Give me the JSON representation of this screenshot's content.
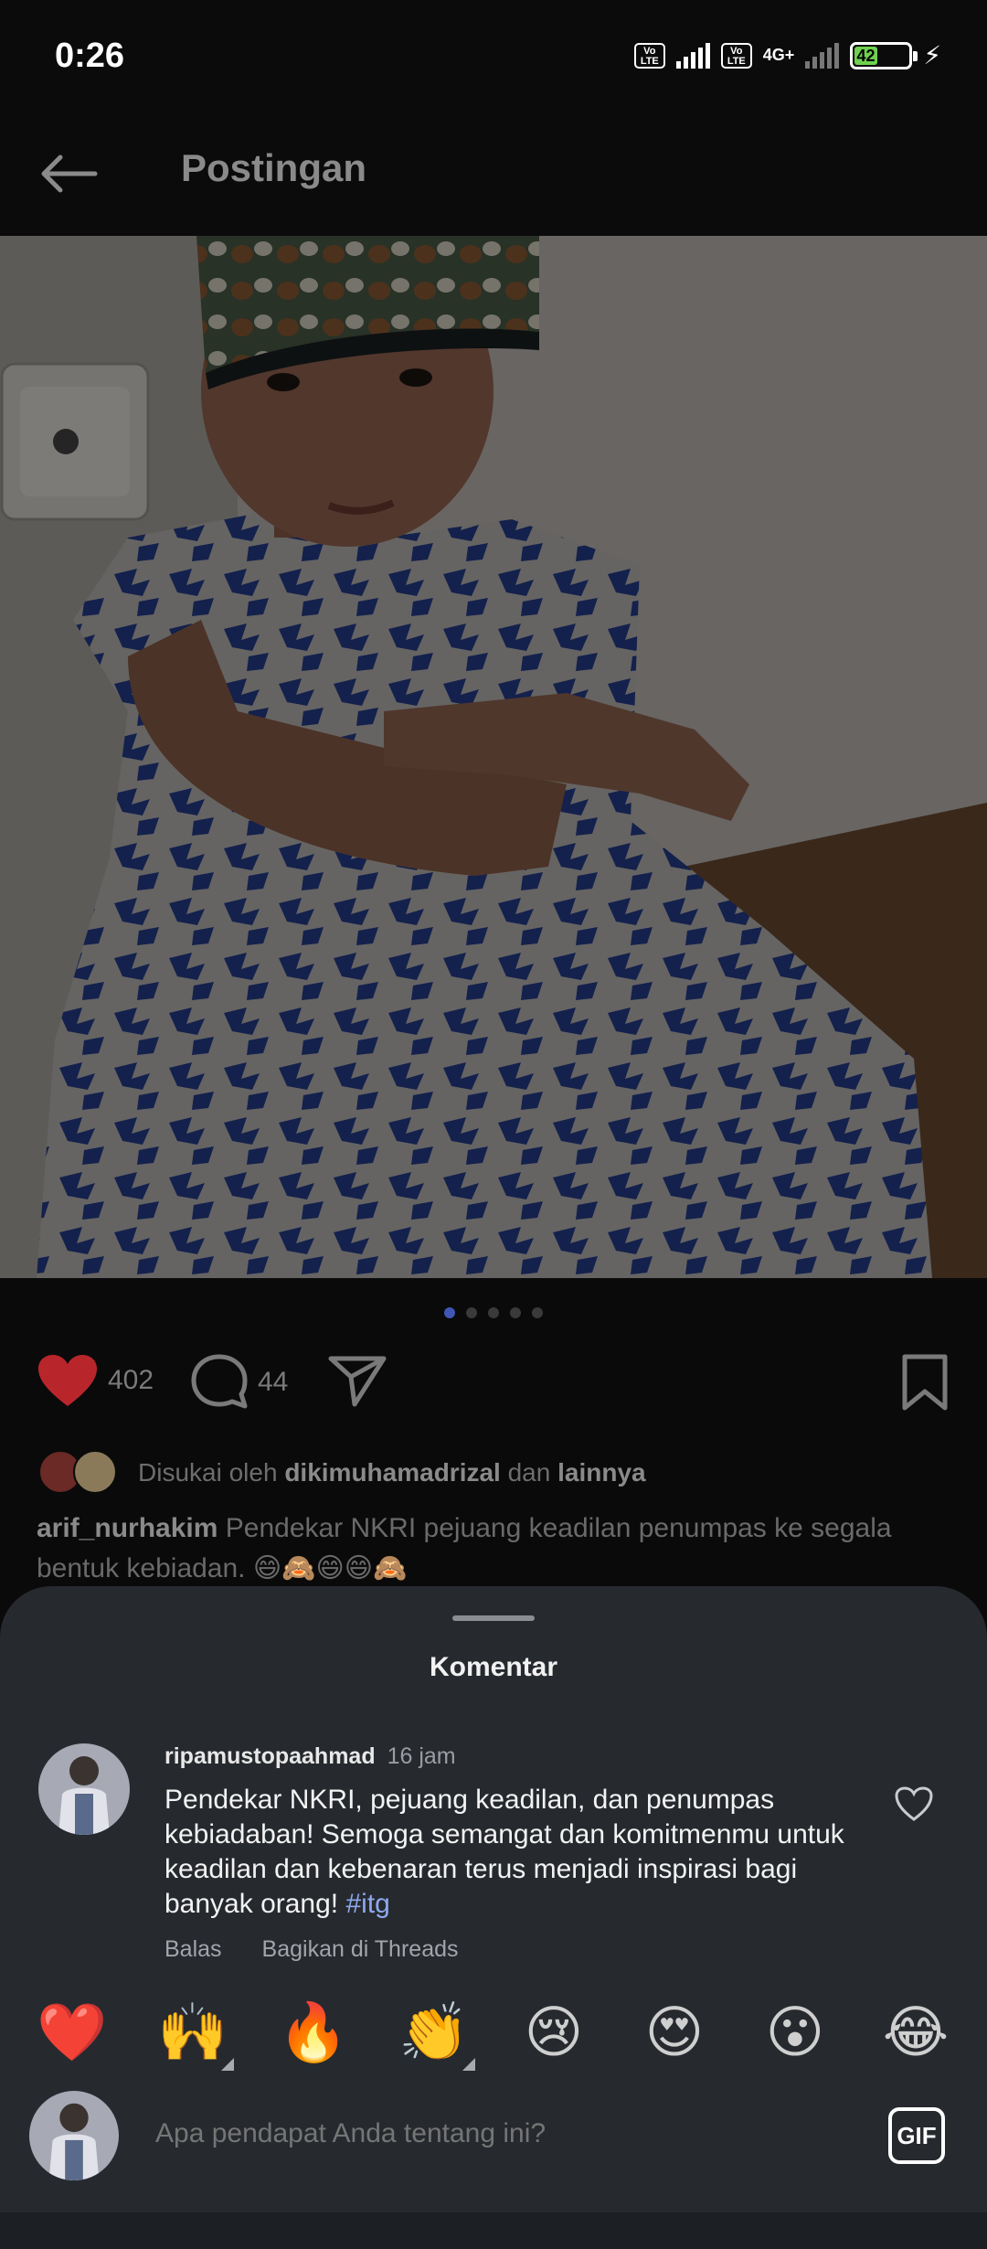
{
  "status": {
    "time": "0:26",
    "volte1": "Vo LTE",
    "volte2": "Vo LTE",
    "network": "4G+",
    "battery": "42"
  },
  "header": {
    "title": "Postingan"
  },
  "post": {
    "likes_count": "402",
    "comments_count": "44",
    "carousel_total": 5,
    "carousel_active": 0,
    "liked_by_prefix": "Disukai oleh",
    "liked_by_user": "dikimuhamadrizal",
    "liked_by_and": "dan",
    "liked_by_more": "lainnya",
    "caption_user": "arif_nurhakim",
    "caption_text": "Pendekar NKRI pejuang keadilan penumpas ke segala bentuk kebiadan. 😄🙈😄😄🙈"
  },
  "comments_sheet": {
    "title": "Komentar",
    "comment": {
      "user": "ripamustopaahmad",
      "time": "16 jam",
      "text": "Pendekar NKRI, pejuang keadilan, dan penumpas kebiadaban! Semoga semangat dan komitmenmu untuk keadilan dan kebenaran terus menjadi inspirasi bagi banyak orang!",
      "hashtag": "#itg",
      "reply_label": "Balas",
      "share_label": "Bagikan di Threads"
    },
    "quick_reactions": [
      "❤️",
      "🙌",
      "🔥",
      "👏",
      "😢",
      "😍",
      "😮",
      "😂"
    ],
    "input_placeholder": "Apa pendapat Anda tentang ini?",
    "gif_label": "GIF"
  },
  "colors": {
    "like_red": "#b8262c",
    "link_blue": "#8fa8ee",
    "sheet_bg": "#262a2f",
    "dot_active": "#3f56b5"
  }
}
